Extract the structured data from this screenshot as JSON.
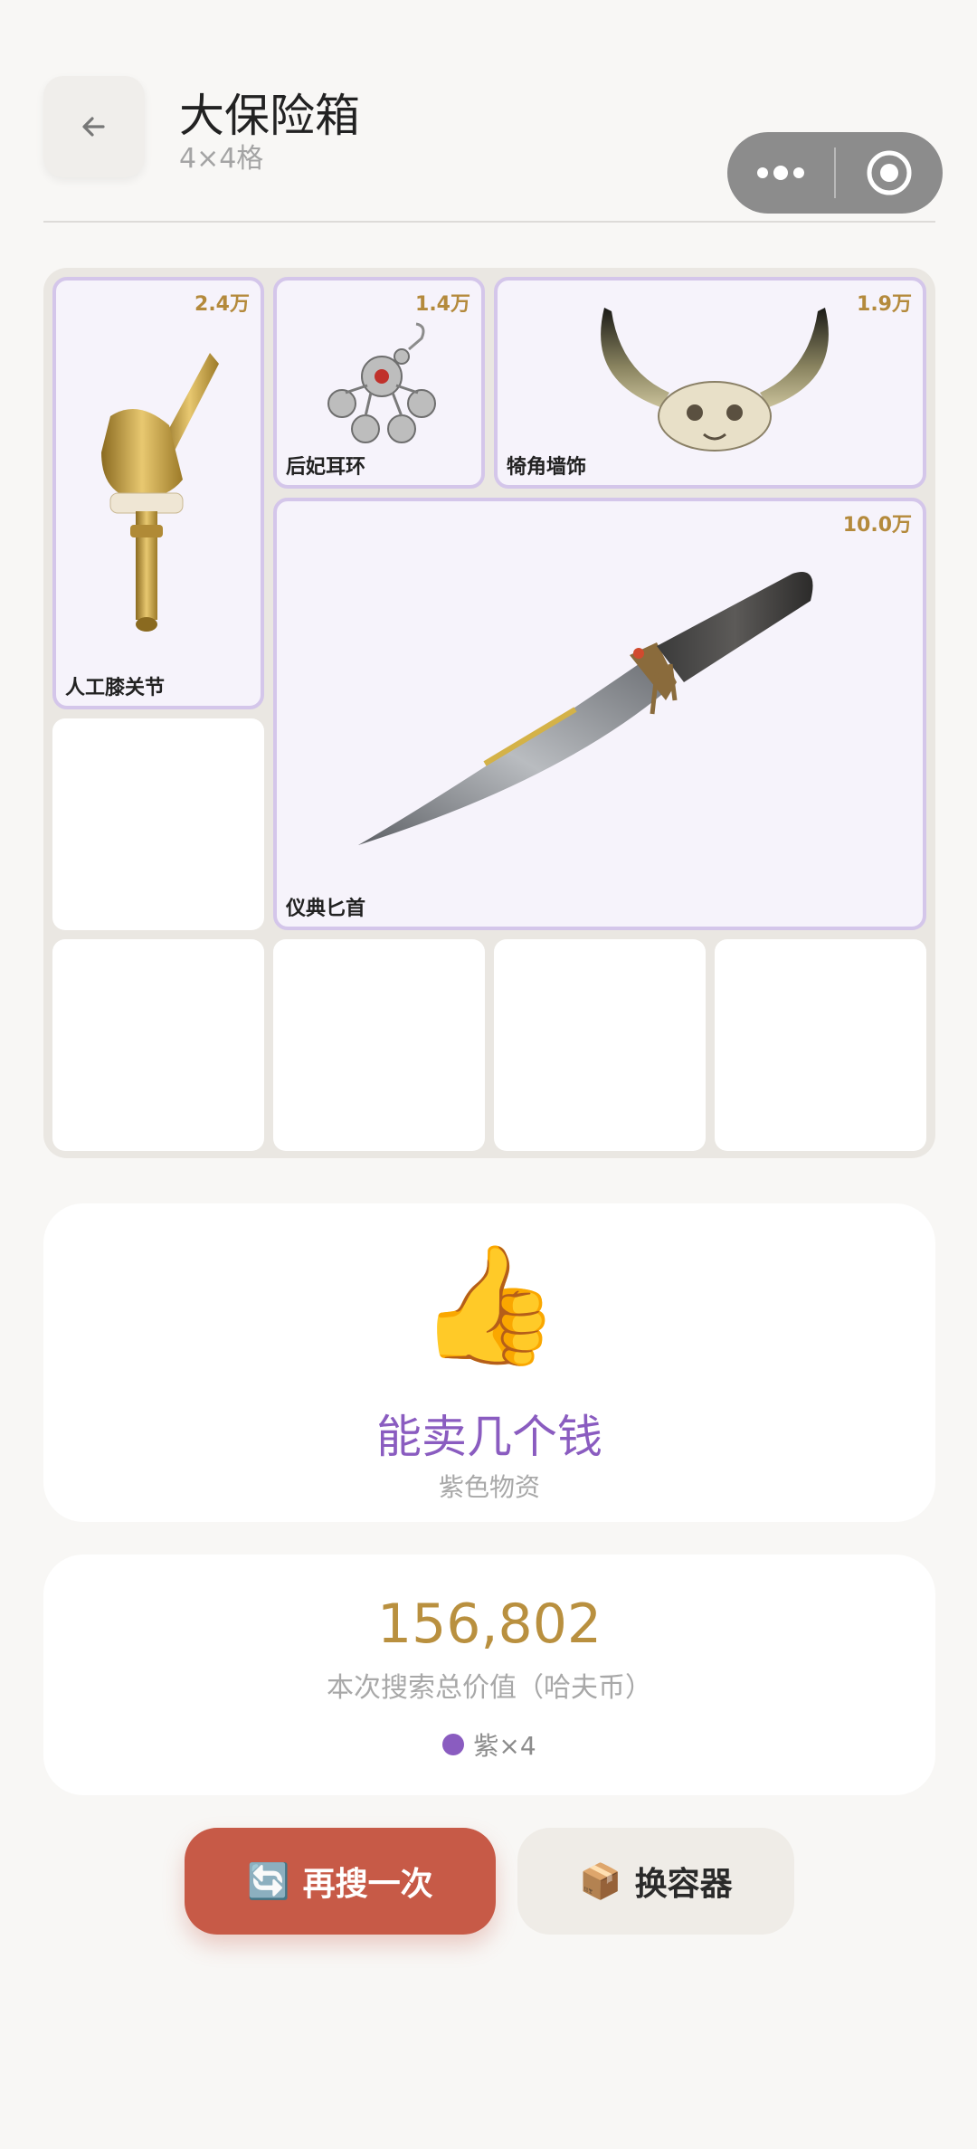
{
  "header": {
    "title": "大保险箱",
    "subtitle": "4×4格"
  },
  "grid": {
    "items": [
      {
        "name": "人工膝关节",
        "price": "2.4万",
        "rarity_color": "#8a5cc0"
      },
      {
        "name": "后妃耳环",
        "price": "1.4万",
        "rarity_color": "#8a5cc0"
      },
      {
        "name": "犄角墙饰",
        "price": "1.9万",
        "rarity_color": "#8a5cc0"
      },
      {
        "name": "仪典匕首",
        "price": "10.0万",
        "rarity_color": "#8a5cc0"
      }
    ]
  },
  "rating": {
    "emoji": "👍",
    "title": "能卖几个钱",
    "subtitle": "紫色物资"
  },
  "summary": {
    "total": "156,802",
    "label": "本次搜索总价值（哈夫币）",
    "tally_text": "紫×4",
    "tally_color": "#8a5cc0"
  },
  "actions": {
    "retry_icon": "🔄",
    "retry_label": "再搜一次",
    "swap_icon": "📦",
    "swap_label": "换容器"
  },
  "colors": {
    "accent_purple": "#8a5cc0",
    "gold": "#b9903f",
    "primary_button": "#c75a47"
  }
}
